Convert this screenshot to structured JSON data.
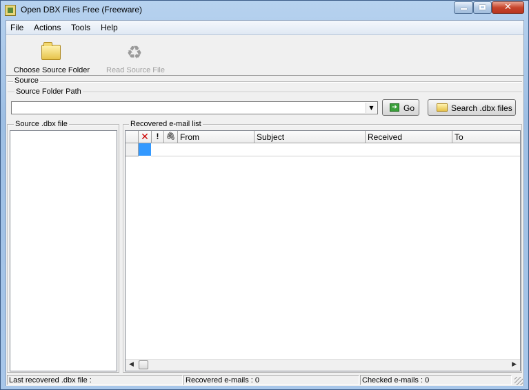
{
  "window": {
    "title": "Open DBX Files Free (Freeware)",
    "close_glyph": "✕"
  },
  "menu": [
    "File",
    "Actions",
    "Tools",
    "Help"
  ],
  "toolbar": {
    "choose_source_folder": "Choose Source Folder",
    "read_source_file": "Read Source File"
  },
  "source": {
    "group_label": "Source",
    "folder_path_label": "Source Folder Path",
    "folder_path_value": "",
    "go_label": "Go",
    "search_label": "Search .dbx files"
  },
  "dbx_panel": {
    "label": "Source .dbx file"
  },
  "email_panel": {
    "label": "Recovered e-mail list",
    "columns": {
      "delete": "✕",
      "priority": "!",
      "attachment": "🖇",
      "from": "From",
      "subject": "Subject",
      "received": "Received",
      "to": "To"
    }
  },
  "status": {
    "last_file": "Last recovered .dbx file :",
    "recovered": "Recovered e-mails : 0",
    "checked": "Checked e-mails : 0"
  },
  "colors": {
    "delete_header": "#cc0000",
    "selected_cell": "#3399ff"
  }
}
